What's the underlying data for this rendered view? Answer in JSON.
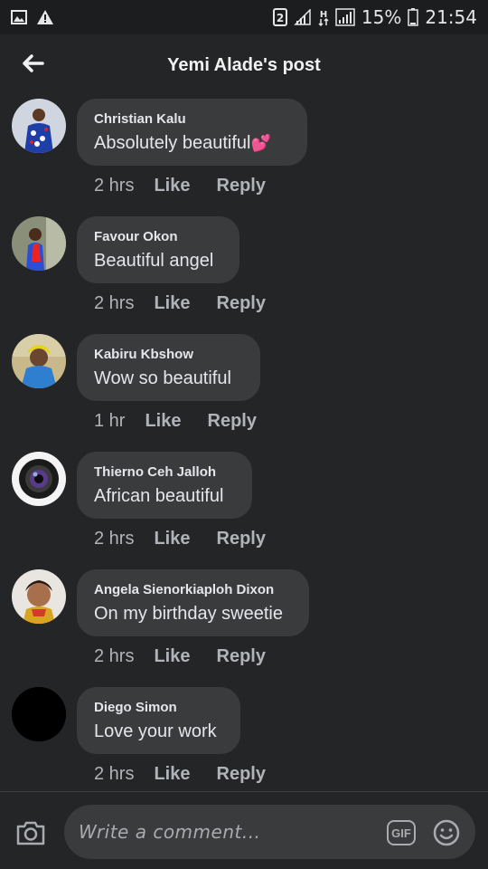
{
  "status_bar": {
    "battery_percent": "15%",
    "time": "21:54",
    "sim_number": "2",
    "network_type": "H"
  },
  "header": {
    "title": "Yemi Alade's post"
  },
  "comments": [
    {
      "author": "Christian Kalu",
      "text": "Absolutely beautiful",
      "emoji": "💕",
      "time": "2 hrs",
      "like_label": "Like",
      "reply_label": "Reply"
    },
    {
      "author": "Favour Okon",
      "text": "Beautiful angel",
      "time": "2 hrs",
      "like_label": "Like",
      "reply_label": "Reply"
    },
    {
      "author": "Kabiru Kbshow",
      "text": "Wow so beautiful",
      "time": "1 hr",
      "like_label": "Like",
      "reply_label": "Reply"
    },
    {
      "author": "Thierno Ceh Jalloh",
      "text": "African beautiful",
      "time": "2 hrs",
      "like_label": "Like",
      "reply_label": "Reply"
    },
    {
      "author": "Angela Sienorkiaploh Dixon",
      "text": "On my birthday sweetie",
      "time": "2 hrs",
      "like_label": "Like",
      "reply_label": "Reply"
    },
    {
      "author": "Diego Simon",
      "text": "Love your work",
      "time": "2 hrs",
      "like_label": "Like",
      "reply_label": "Reply"
    }
  ],
  "composer": {
    "placeholder": "Write a comment...",
    "gif_label": "GIF"
  }
}
